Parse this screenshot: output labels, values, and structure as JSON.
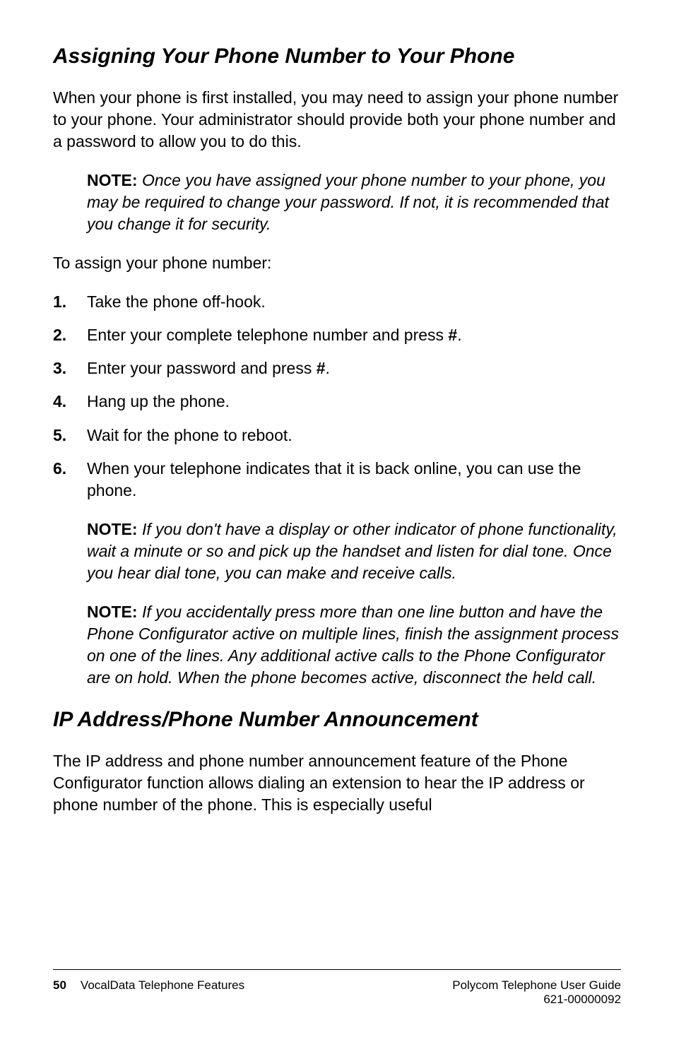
{
  "heading1": "Assigning Your Phone Number to Your Phone",
  "intro": "When your phone is first installed, you may need to assign your phone number to your phone. Your administrator should provide both your phone number and a password to allow you to do this.",
  "note1_label": "NOTE:",
  "note1_text": " Once you have assigned your phone number to your phone, you may be required to change your password. If not, it is recommended that you change it for security.",
  "list_intro": "To assign your phone number:",
  "steps": [
    {
      "num": "1.",
      "text": " Take the phone off-hook."
    },
    {
      "num": "2.",
      "pre": "Enter your complete telephone number and press ",
      "bold": "#",
      "post": "."
    },
    {
      "num": "3.",
      "pre": "Enter your password and press ",
      "bold": "#",
      "post": "."
    },
    {
      "num": "4.",
      "text": "Hang up the phone."
    },
    {
      "num": "5.",
      "text": "Wait for the phone to reboot."
    },
    {
      "num": "6.",
      "text": "When your telephone indicates that it is back online, you can use the phone."
    }
  ],
  "note2_label": "NOTE:",
  "note2_text": " If you don't have a display or other indicator of phone functionality, wait a minute or so and pick up the handset and listen for dial tone. Once you hear dial tone, you can make and receive calls.",
  "note3_label": "NOTE:",
  "note3_text": " If you accidentally press more than one line button and have the Phone Configurator active on multiple lines, finish the assignment process on one of the lines. Any additional active calls to the Phone Configurator are on hold. When the phone becomes active, disconnect the held call.",
  "heading2": "IP Address/Phone Number Announcement",
  "body2": "The IP address and phone number announcement feature of the Phone Configurator function allows dialing an extension to hear the IP address or phone number of the phone. This is especially useful",
  "footer": {
    "page": "50",
    "left": "VocalData Telephone Features",
    "right_line1": "Polycom Telephone User Guide",
    "right_line2": "621-00000092"
  }
}
